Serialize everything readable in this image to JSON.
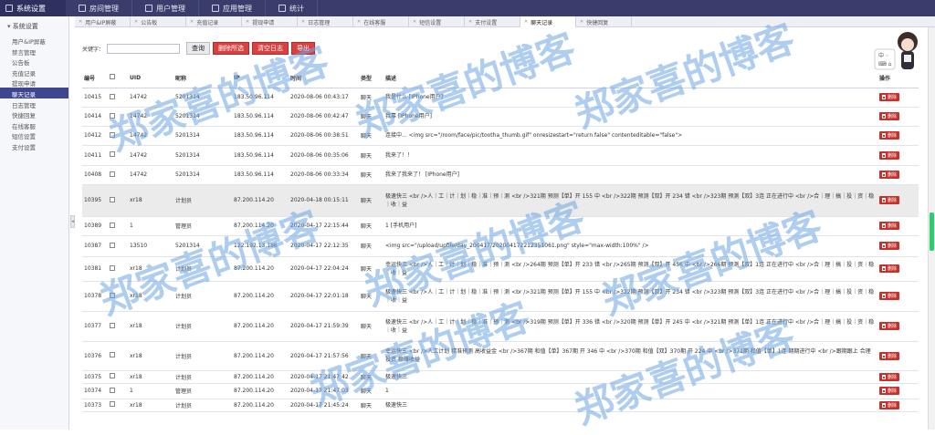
{
  "topbar": {
    "brand": "系统设置",
    "nav": [
      "房间管理",
      "用户管理",
      "应用管理",
      "统计"
    ]
  },
  "sidebar": {
    "section": "系统设置",
    "items": [
      "用户&IP屏蔽",
      "禁言管理",
      "公告板",
      "充值记录",
      "提现申请",
      "聊天记录",
      "日志管理",
      "快捷回复",
      "在线客服",
      "短信设置",
      "支付设置"
    ],
    "active_index": 5
  },
  "tabs": [
    "用户&IP屏蔽",
    "公告板",
    "充值记录",
    "提现申请",
    "日志管理",
    "在线客服",
    "短信设置",
    "支付设置",
    "聊天记录",
    "快捷回复"
  ],
  "active_tab": 8,
  "toolbar": {
    "keyword_label": "关键字：",
    "query": "查询",
    "delete_selected": "删除所选",
    "clear_log": "清空日志",
    "export": "导出"
  },
  "table": {
    "headers": [
      "编号",
      "",
      "UID",
      "昵称",
      "IP",
      "时间",
      "类型",
      "描述",
      "操作"
    ],
    "delete_label": "删除",
    "rows": [
      {
        "id": "10415",
        "uid": "14742",
        "nick": "5201314",
        "ip": "183.50.96.114",
        "time": "2020-08-06 00:43:17",
        "type": "聊天",
        "desc": "我是什么 [IPhone用户]"
      },
      {
        "id": "10414",
        "uid": "14742",
        "nick": "5201314",
        "ip": "183.50.96.114",
        "time": "2020-08-06 00:42:47",
        "type": "聊天",
        "desc": "我靠 [IPhone用户]"
      },
      {
        "id": "10412",
        "uid": "14742",
        "nick": "5201314",
        "ip": "183.50.96.114",
        "time": "2020-08-06 00:38:51",
        "type": "聊天",
        "desc": "连接中... <img src=\"/room/face/pic/tootha_thumb.gif\" onresizestart=\"return false\" contenteditable=\"false\">"
      },
      {
        "id": "10411",
        "uid": "14742",
        "nick": "5201314",
        "ip": "183.50.96.114",
        "time": "2020-08-06 00:35:06",
        "type": "聊天",
        "desc": "我来了！！"
      },
      {
        "id": "10408",
        "uid": "14742",
        "nick": "5201314",
        "ip": "183.50.96.114",
        "time": "2020-08-06 00:33:34",
        "type": "聊天",
        "desc": "我来了我来了！ [IPhone用户]"
      },
      {
        "id": "10395",
        "uid": "xr18",
        "nick": "计划员",
        "ip": "87.200.114.20",
        "time": "2020-04-18 00:15:11",
        "type": "聊天",
        "desc": "极速快三 <br />人｜工｜计｜划｜稳｜准｜预｜测 <br />321期 预测【单】开 155 中 <br />322期 预测【双】开 234 错 <br />323期 预测【双】3连 正在进行中 <br />合｜理｜搞｜投｜资｜稳｜收｜益",
        "hl": true
      },
      {
        "id": "10389",
        "uid": "1",
        "nick": "管理员",
        "ip": "87.200.114.20",
        "time": "2020-04-17 22:15:44",
        "type": "聊天",
        "desc": "1 [手机用户]"
      },
      {
        "id": "10387",
        "uid": "13510",
        "nick": "5201314",
        "ip": "122.192.13.186",
        "time": "2020-04-17 22:12:35",
        "type": "聊天",
        "desc": "<img src=\"/upload/upfile/day_200417/202004172212351061.png\" style=\"max-width:100%\" />"
      },
      {
        "id": "10381",
        "uid": "xr18",
        "nick": "计划员",
        "ip": "87.200.114.20",
        "time": "2020-04-17 22:04:24",
        "type": "聊天",
        "desc": "幸运快三 <br />人｜工｜计｜划｜稳｜准｜预｜测 <br />264期 预测【单】开 233 错 <br />265期 预测【双】开 456 中 <br />266期 预测【双】1连 正在进行中 <br />合｜理｜搞｜投｜资｜稳｜收｜益"
      },
      {
        "id": "10378",
        "uid": "xr18",
        "nick": "计划员",
        "ip": "87.200.114.20",
        "time": "2020-04-17 22:01:18",
        "type": "聊天",
        "desc": "极速快三 <br />人｜工｜计｜划｜稳｜准｜预｜测 <br />321期 预测【单】开 155 中 <br />322期 预测【双】开 234 错 <br />323期 预测【双】3连 正在进行中 <br />合｜理｜搞｜投｜资｜稳｜收｜益"
      },
      {
        "id": "10377",
        "uid": "xr18",
        "nick": "计划员",
        "ip": "87.200.114.20",
        "time": "2020-04-17 21:59:39",
        "type": "聊天",
        "desc": "极速快三 <br />人｜工｜计｜划｜稳｜准｜预｜测 <br />319期 预测【单】开 336 错 <br />320期 预测【单】开 245 中 <br />321期 预测【单】1连 正在进行中 <br />合｜理｜搞｜投｜资｜稳｜收｜益"
      },
      {
        "id": "10376",
        "uid": "xr18",
        "nick": "计划员",
        "ip": "87.200.114.20",
        "time": "2020-04-17 21:57:56",
        "type": "聊天",
        "desc": "幸运快三 <br />人工计划 精准预测 高收益金 <br />367期 和值【单】367期 开 346 中 <br />370期 和值【双】370期 开 224 中 <br />371期 和值【单】1连 期期进行中 <br />跟期跟上 合理投资 稳赚收益"
      },
      {
        "id": "10375",
        "uid": "xr18",
        "nick": "计划员",
        "ip": "87.200.114.20",
        "time": "2020-04-17 21:47:42",
        "type": "聊天",
        "desc": "极速快三"
      },
      {
        "id": "10374",
        "uid": "1",
        "nick": "管理员",
        "ip": "87.200.114.20",
        "time": "2020-04-17 21:47:03",
        "type": "聊天",
        "desc": "1"
      },
      {
        "id": "10373",
        "uid": "xr18",
        "nick": "计划员",
        "ip": "87.200.114.20",
        "time": "2020-04-17 21:45:24",
        "type": "聊天",
        "desc": "极速快三"
      }
    ]
  },
  "watermark": "郑家喜的博客",
  "colors": {
    "topbar": "#3a3d6b",
    "active_side": "#3f4690",
    "danger": "#c8302b",
    "watermark": "#6ea5e1",
    "scroll_thumb": "#2ecc71"
  }
}
